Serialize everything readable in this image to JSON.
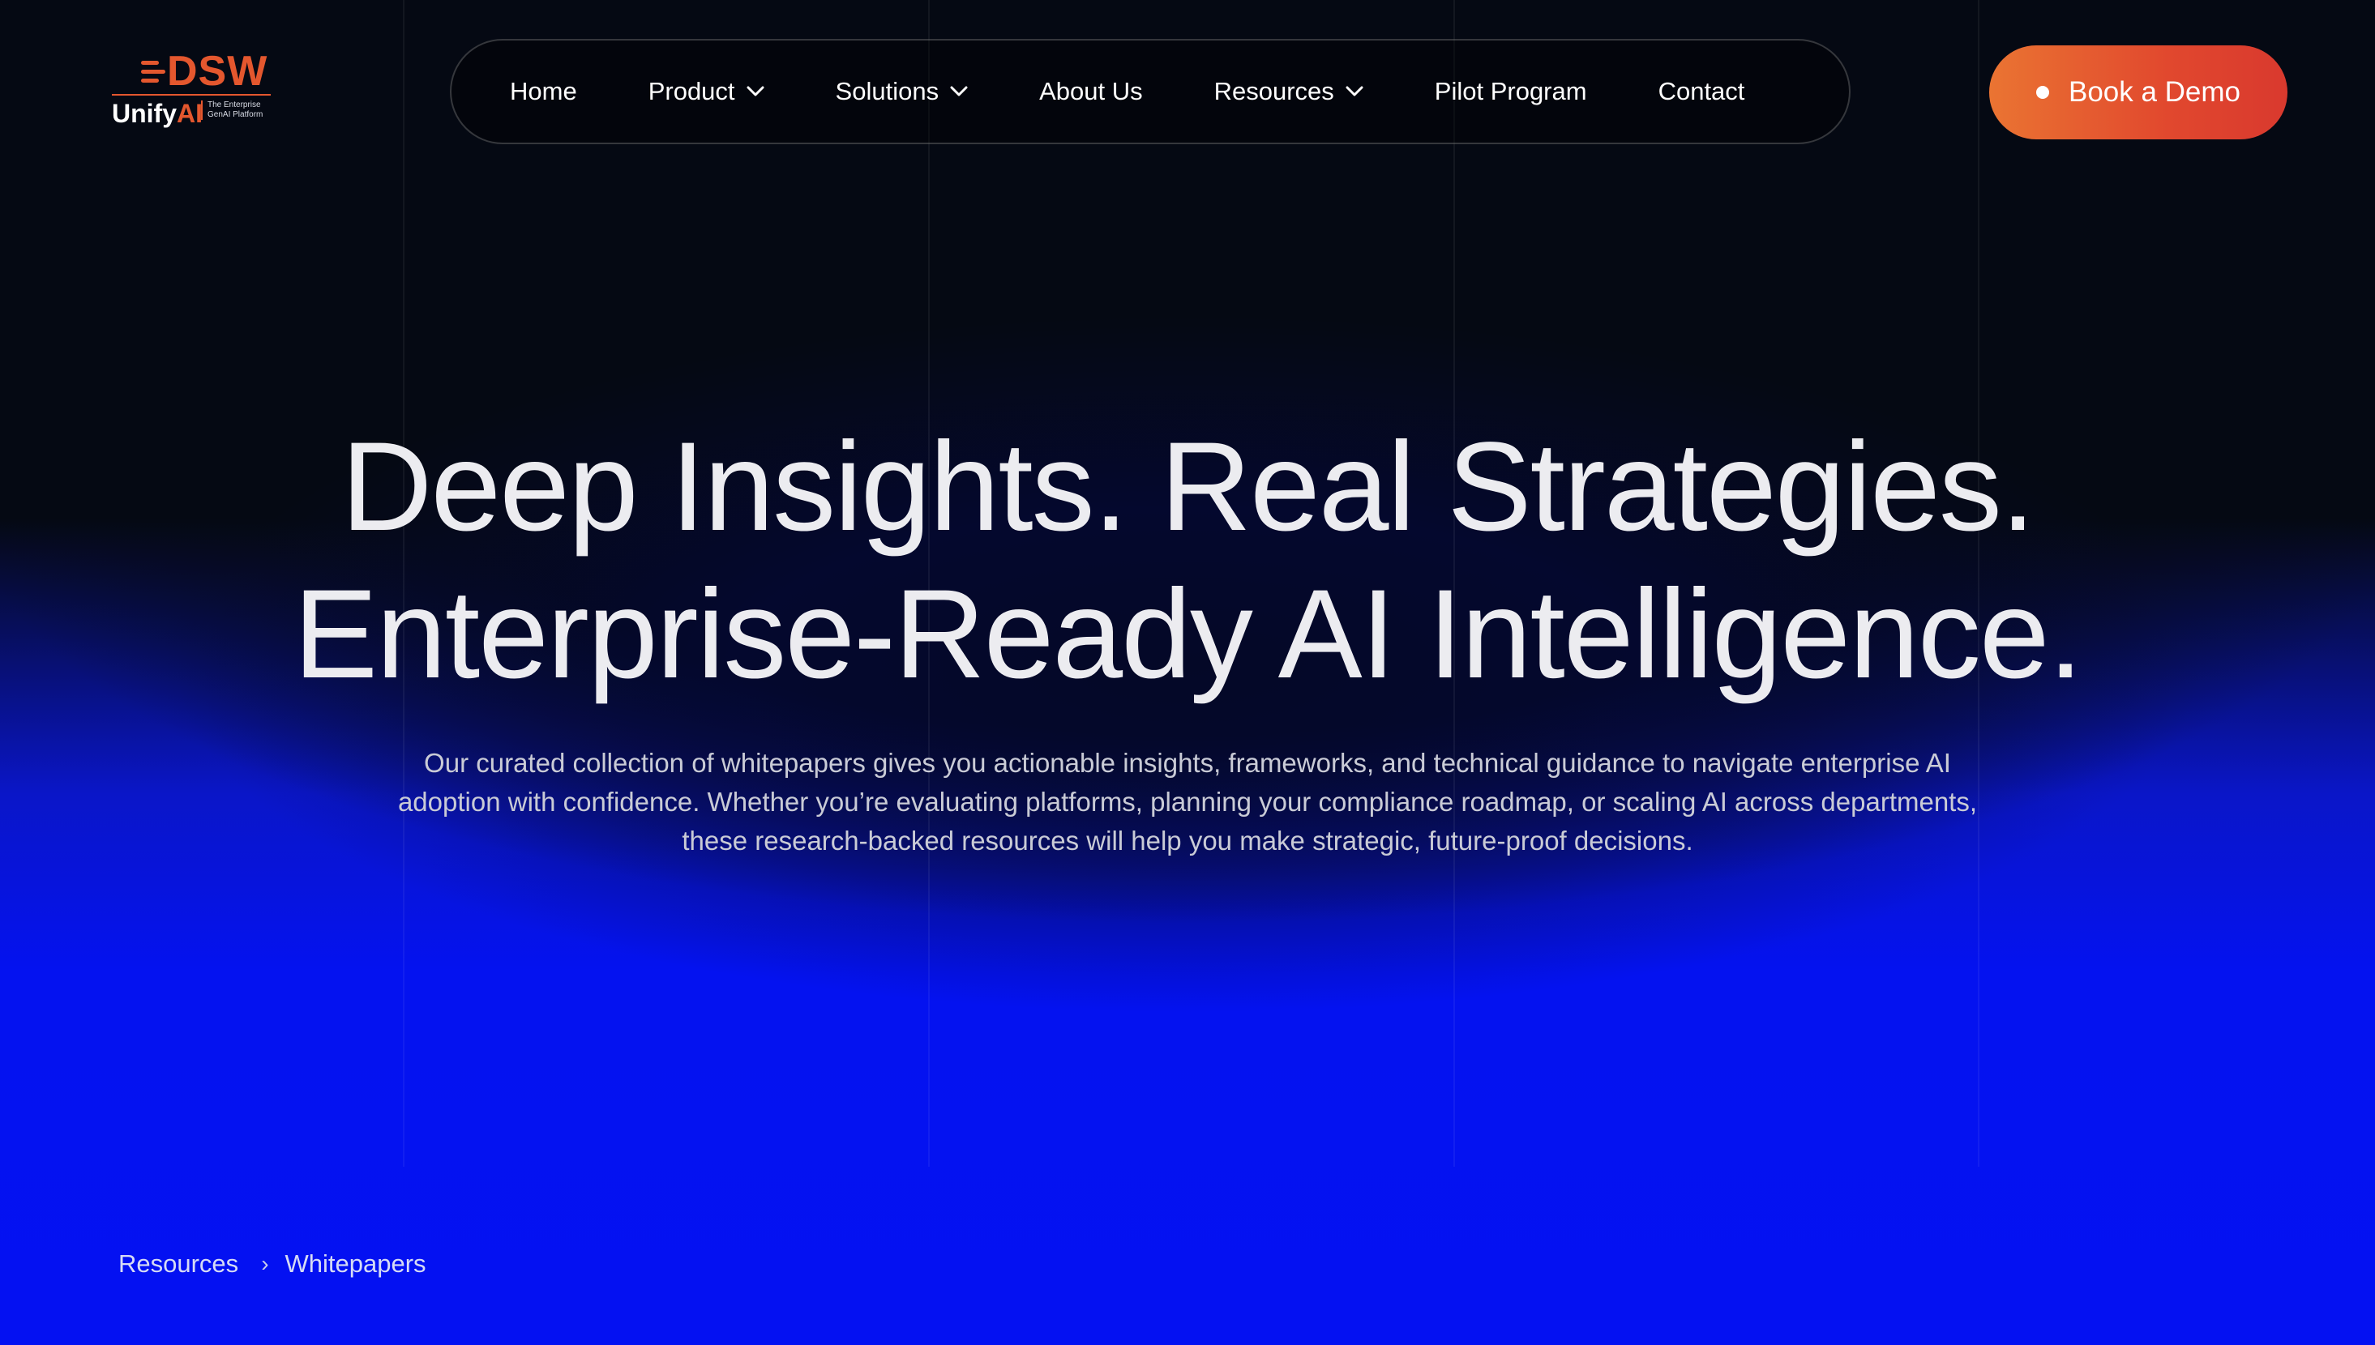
{
  "brand": {
    "logo_mark": "DSW",
    "logo_name": "Unify",
    "logo_name_accent": "AI",
    "logo_tagline": "The Enterprise GenAI Platform",
    "accent_color": "#e4572e"
  },
  "nav": {
    "items": [
      {
        "label": "Home",
        "has_dropdown": false
      },
      {
        "label": "Product",
        "has_dropdown": true
      },
      {
        "label": "Solutions",
        "has_dropdown": true
      },
      {
        "label": "About Us",
        "has_dropdown": false
      },
      {
        "label": "Resources",
        "has_dropdown": true
      },
      {
        "label": "Pilot Program",
        "has_dropdown": false
      },
      {
        "label": "Contact",
        "has_dropdown": false
      }
    ],
    "dropdown_icon": "chevron-down-icon"
  },
  "cta": {
    "label": "Book a Demo",
    "gradient_start": "#ea7432",
    "gradient_end": "#d9392e"
  },
  "hero": {
    "title_line1": "Deep Insights. Real Strategies.",
    "title_line2": "Enterprise-Ready AI Intelligence.",
    "subtitle_line1": "Our curated collection of whitepapers gives you actionable insights, frameworks, and technical guidance to navigate enterprise AI",
    "subtitle_line2": "adoption with confidence. Whether you’re evaluating platforms, planning your compliance roadmap, or scaling AI across departments,",
    "subtitle_line3": "these research-backed resources will help you make strategic, future-proof decisions."
  },
  "breadcrumb": {
    "items": [
      "Resources",
      "Whitepapers"
    ],
    "separator": "›"
  },
  "colors": {
    "background": "#050913",
    "glow": "#0411f2"
  }
}
